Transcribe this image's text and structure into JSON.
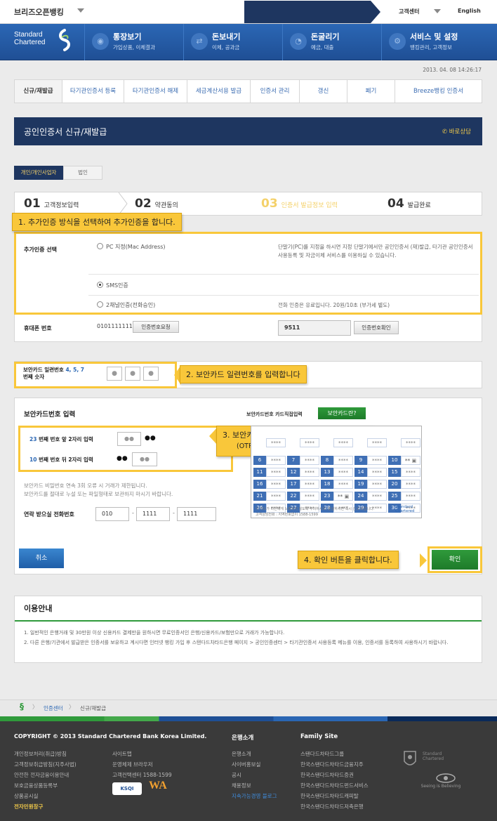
{
  "topbar": {
    "site_title": "브리즈오픈뱅킹",
    "customer_center": "고객센터",
    "language": "English"
  },
  "brand": {
    "line1": "Standard",
    "line2": "Chartered"
  },
  "nav": [
    {
      "title": "통장보기",
      "sub": "가입상품, 이체결과",
      "icon": "eye-icon"
    },
    {
      "title": "돈보내기",
      "sub": "이체, 공과금",
      "icon": "transfer-icon"
    },
    {
      "title": "돈굴리기",
      "sub": "예금, 대출",
      "icon": "growth-icon"
    },
    {
      "title": "서비스 및 설정",
      "sub": "뱅킹관리, 고객정보",
      "icon": "gear-icon"
    }
  ],
  "datetime": "2013. 04. 08 14:26:17",
  "tabs": [
    "신규/재발급",
    "타기관인증서 등록",
    "타기관인증서 해제",
    "세금계산서용 발급",
    "인증서 관리",
    "갱신",
    "폐기",
    "Breeze뱅킹 인증서"
  ],
  "page_title": "공인인증서 신규/재발급",
  "consult": "바로상담",
  "subtabs": [
    "개인/개인사업자",
    "법인"
  ],
  "steps": [
    {
      "num": "01",
      "label": "고객정보입력"
    },
    {
      "num": "02",
      "label": "약관동의"
    },
    {
      "num": "03",
      "label": "인증서 발급정보 입력"
    },
    {
      "num": "04",
      "label": "발급완료"
    }
  ],
  "callouts": {
    "c1": "1. 추가인증 방식을 선택하여 추가인증을 합니다.",
    "c2": "2. 보안카드 일련번호를 입력합니다",
    "c3_line1": "3. 보안카드번호를 입력합니다.",
    "c3_line2": "(OTP 이용 고객은 OTP 응답값을 입력합니다.)",
    "c4": "4. 확인 버튼을 클릭합니다."
  },
  "auth": {
    "label": "추가인증 선택",
    "opt_pc": "PC 지정(Mac Address)",
    "desc_pc": "단말기(PC)를 지정을 하시면 지정 단말기에서만 공인인증서 (재)발급, 타기관 공인인증서 사용등록 및 자금이체 서비스를 이용하실 수 있습니다.",
    "opt_sms": "SMS인증",
    "opt_phone": "2채널인증(전화승인)",
    "desc_phone": "전화 인증은 유료입니다. 20원/10초 (부가세 별도)"
  },
  "phone": {
    "label": "휴대폰 번호",
    "value": "01011111111",
    "request_btn": "인증번호요청",
    "code": "9511",
    "confirm_btn": "인증번호확인"
  },
  "serial": {
    "label_part1": "보안카드 일련번호",
    "digits": "4, 5, 7",
    "label_part2": "번째 숫자"
  },
  "card": {
    "title": "보안카드번호 입력",
    "direct_label": "보안카드번호 카드직접입력",
    "what_btn": "보안카드란?",
    "row1_num": "23",
    "row1_text": "번째 번호 앞 2자리 입력",
    "row2_num": "10",
    "row2_text": "번째 번호 뒤 2자리 입력",
    "notice1": "보안카드 비밀번호 연속 3회 오류 시 거래가 제한됩니다.",
    "notice2": "보안카드를 절대로 누설 또는 파일형태로 보관하지 마시기 바랍니다.",
    "contact_label": "연락 받으실 전화번호",
    "tel1": "010",
    "tel2": "1111",
    "tel3": "1111",
    "grid_note": "이 카드가 타인에게 노출되지 않도록 주의하시고, 분실하시면 즉시 신고 바랍니다.",
    "grid_note2": "고객상담전화 : 지역번호없이 1588-1599",
    "grid_numbers": [
      "6",
      "7",
      "8",
      "9",
      "10",
      "11",
      "12",
      "13",
      "14",
      "15",
      "16",
      "17",
      "18",
      "19",
      "20",
      "21",
      "22",
      "23",
      "24",
      "25",
      "26",
      "27",
      "28",
      "29",
      "30"
    ]
  },
  "buttons": {
    "cancel": "취소",
    "confirm": "확인"
  },
  "guide": {
    "title": "이용안내",
    "item1": "일반적인 은행거래 및 30만원 이상 신용카드 결제만을 원하시면 무료인증서인 은행/신용카드/보험만으로 거래가 가능합니다.",
    "item2": "다른 은행/기관에서 발급받은 인증서를 보유하고 계시다면 인터넷 뱅킹 가입 후 스탠다드차타드은행 페이지 > 공인인증센터 > 타기관인증서 사용등록 메뉴를 이용, 인증서를 등록하여 사용하시기 바랍니다."
  },
  "breadcrumb": [
    "인증센터",
    "신규/재발급"
  ],
  "footer": {
    "copyright": "COPYRIGHT © 2013 Standard Chartered Bank Korea Limited.",
    "col1": [
      "개인정보처리(취급)방침",
      "고객정보취급방침(지주사법)",
      "안전한 전자금융이용안내",
      "보호금융상품등록부",
      "상품공시실",
      "전자민원창구"
    ],
    "col2": [
      "사이트맵",
      "운영체제 브라우저",
      "고객컨택센터 1588-1599"
    ],
    "col3_title": "은행소개",
    "col3": [
      "은행소개",
      "사이버홍보실",
      "공시",
      "채용정보",
      "지속가능경영 블로그"
    ],
    "col4_title": "Family Site",
    "col4": [
      "스탠다드차타드그룹",
      "한국스탠다드차타드금융지주",
      "한국스탠다드차타드증권",
      "한국스탠다드차타드펀드서비스",
      "한국스탠다드차타드캐피탈",
      "한국스탠다드차타드저축은행"
    ],
    "badge_ksqi": "KSQI",
    "badge_wa": "WA",
    "seeing": "Seeing is Believing"
  }
}
